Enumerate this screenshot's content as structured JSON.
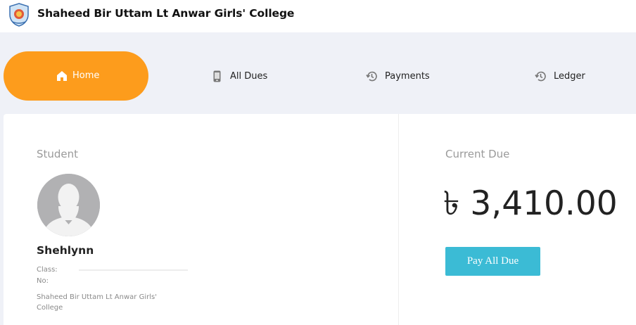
{
  "header": {
    "title": "Shaheed Bir Uttam Lt Anwar Girls' College",
    "logo_icon": "college-shield-logo"
  },
  "nav": {
    "items": [
      {
        "label": "Home",
        "icon": "home-icon",
        "active": true
      },
      {
        "label": "All Dues",
        "icon": "phone-icon",
        "active": false
      },
      {
        "label": "Payments",
        "icon": "history-icon",
        "active": false
      },
      {
        "label": "Ledger",
        "icon": "history-icon",
        "active": false
      }
    ]
  },
  "student": {
    "section_label": "Student",
    "name": "Shehlynn",
    "class_label": "Class:",
    "no_label": "No:",
    "institution": "Shaheed Bir Uttam Lt Anwar Girls' College"
  },
  "due": {
    "section_label": "Current Due",
    "amount": "৳ 3,410.00",
    "pay_button": "Pay All Due"
  },
  "colors": {
    "accent": "#fd9c1c",
    "pay_button": "#3bbbd5",
    "background": "#eff1f7"
  }
}
